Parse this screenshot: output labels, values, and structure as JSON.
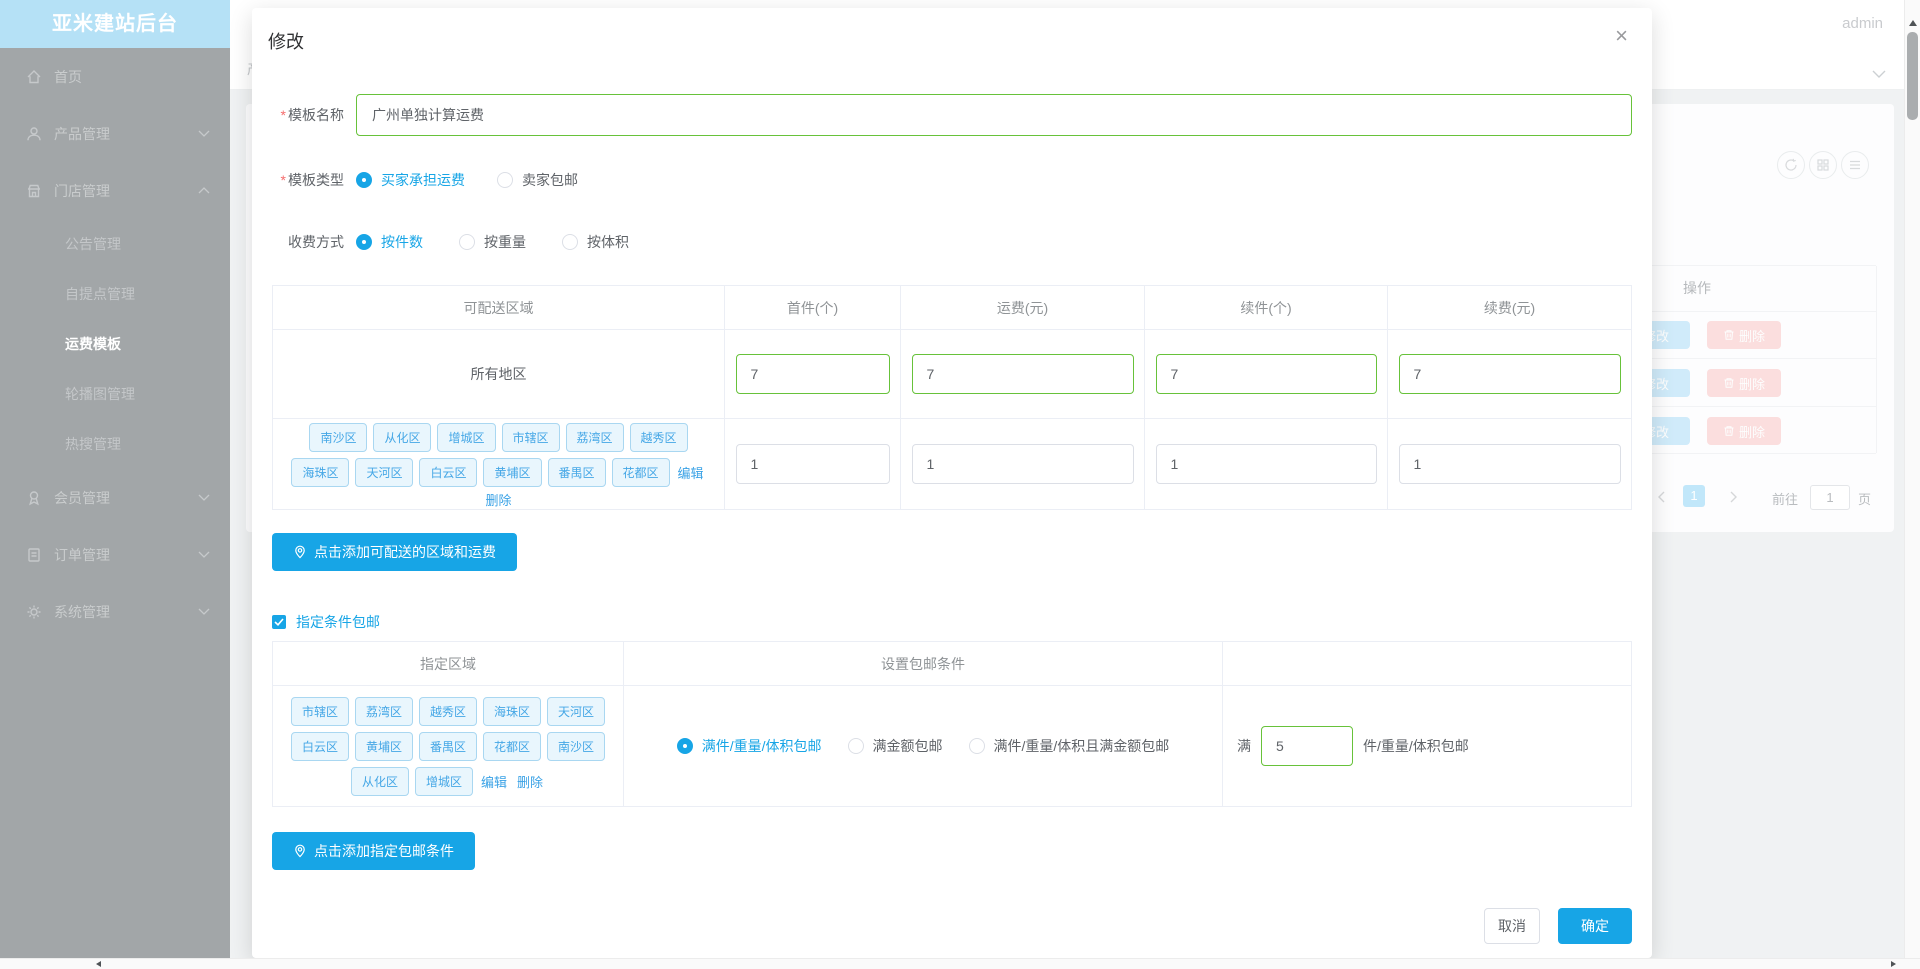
{
  "app": {
    "title": "亚米建站后台",
    "user": "admin",
    "partial_tab": "产"
  },
  "colors": {
    "accent": "#17a5e6",
    "green": "#67c23a",
    "link": "#3aa2e6",
    "tag_text": "#45a7e6",
    "tag_bg": "#e9f6fd",
    "tag_border": "#a9d7f1"
  },
  "sidebar": {
    "items": [
      {
        "label": "首页",
        "icon": "home"
      },
      {
        "label": "产品管理",
        "icon": "user",
        "chevron": "down"
      },
      {
        "label": "门店管理",
        "icon": "shop",
        "chevron": "up",
        "children": [
          "公告管理",
          "自提点管理",
          "运费模板",
          "轮播图管理",
          "热搜管理"
        ],
        "active_child": "运费模板"
      },
      {
        "label": "会员管理",
        "icon": "badge",
        "chevron": "down"
      },
      {
        "label": "订单管理",
        "icon": "order",
        "chevron": "down"
      },
      {
        "label": "系统管理",
        "icon": "gear",
        "chevron": "down"
      }
    ]
  },
  "background": {
    "ops_header": "操作",
    "actions": {
      "edit": "修改",
      "delete": "删除"
    },
    "pagination": {
      "current": "1",
      "goto_label": "前往",
      "goto_value": "1",
      "page_label": "页"
    }
  },
  "modal": {
    "title": "修改",
    "close_icon": "×",
    "fields": {
      "name": {
        "label": "模板名称",
        "value": "广州单独计算运费"
      },
      "type": {
        "label": "模板类型",
        "options": [
          "买家承担运费",
          "卖家包邮"
        ],
        "selected": "买家承担运费"
      },
      "charge": {
        "label": "收费方式",
        "options": [
          "按件数",
          "按重量",
          "按体积"
        ],
        "selected": "按件数"
      }
    },
    "fee_table": {
      "headers": [
        "可配送区域",
        "首件(个)",
        "运费(元)",
        "续件(个)",
        "续费(元)"
      ],
      "rows": [
        {
          "region": "所有地区",
          "values": [
            "7",
            "7",
            "7",
            "7"
          ]
        },
        {
          "tags": [
            "南沙区",
            "从化区",
            "增城区",
            "市辖区",
            "荔湾区",
            "越秀区",
            "海珠区",
            "天河区",
            "白云区",
            "黄埔区",
            "番禺区",
            "花都区"
          ],
          "actions": [
            "编辑",
            "删除"
          ],
          "values": [
            "1",
            "1",
            "1",
            "1"
          ]
        }
      ]
    },
    "add_region_button": "点击添加可配送的区域和运费",
    "free_shipping": {
      "checkbox_label": "指定条件包邮",
      "checked": true,
      "table": {
        "headers": [
          "指定区域",
          "设置包邮条件",
          ""
        ],
        "row": {
          "tags": [
            "市辖区",
            "荔湾区",
            "越秀区",
            "海珠区",
            "天河区",
            "白云区",
            "黄埔区",
            "番禺区",
            "花都区",
            "南沙区",
            "从化区",
            "增城区"
          ],
          "actions": [
            "编辑",
            "删除"
          ],
          "conditions": [
            "满件/重量/体积包邮",
            "满金额包邮",
            "满件/重量/体积且满金额包邮"
          ],
          "selected": "满件/重量/体积包邮",
          "threshold": {
            "prefix": "满",
            "value": "5",
            "suffix": "件/重量/体积包邮"
          }
        }
      },
      "add_button": "点击添加指定包邮条件"
    },
    "footer": {
      "cancel": "取消",
      "confirm": "确定"
    }
  }
}
